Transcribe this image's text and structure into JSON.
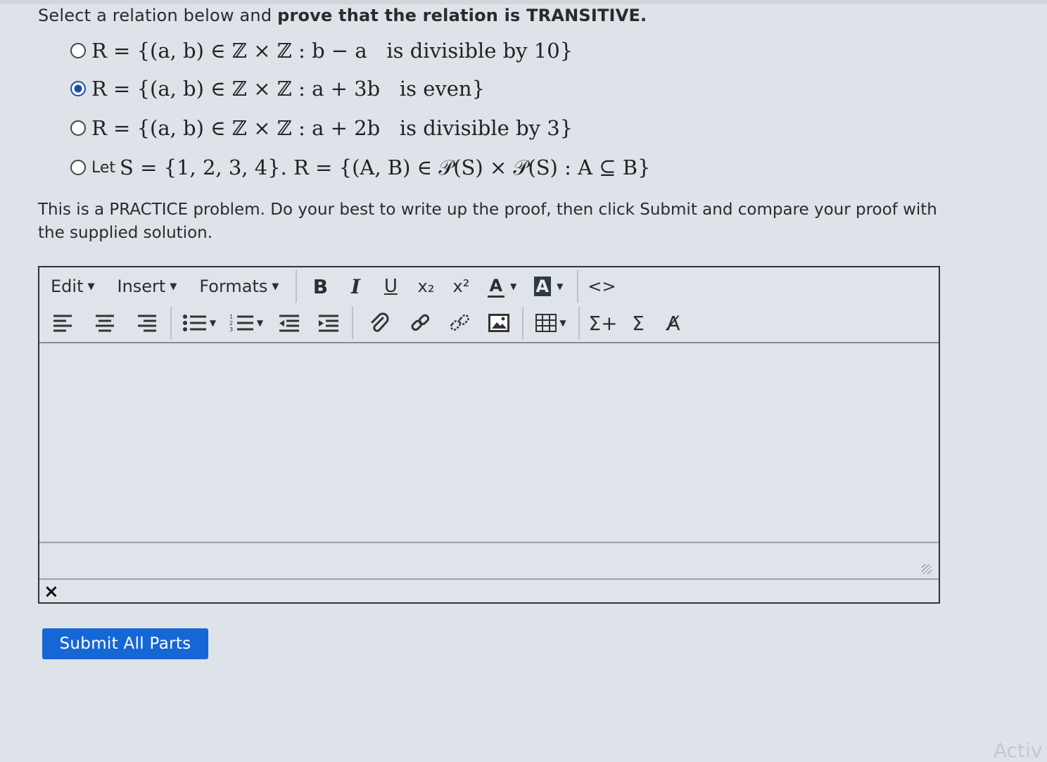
{
  "question": {
    "prompt_plain": "Select a relation below and ",
    "prompt_bold": "prove that the relation is TRANSITIVE."
  },
  "options": [
    {
      "prefix": "",
      "text": "R = {(a, b) ∈ ℤ × ℤ : b − a   is divisible by 10}",
      "selected": false
    },
    {
      "prefix": "",
      "text": "R = {(a, b) ∈ ℤ × ℤ : a + 3b   is even}",
      "selected": true
    },
    {
      "prefix": "",
      "text": "R = {(a, b) ∈ ℤ × ℤ : a + 2b   is divisible by 3}",
      "selected": false
    },
    {
      "prefix": "Let",
      "text": "S = {1, 2, 3, 4}. R = {(A, B) ∈ 𝒫(S) × 𝒫(S) : A ⊆ B}",
      "selected": false
    }
  ],
  "instructions": "This is a PRACTICE problem. Do your best to write up the proof, then click Submit and compare your proof with the supplied solution.",
  "toolbar": {
    "menus": [
      "Edit",
      "Insert",
      "Formats"
    ],
    "bold": "B",
    "italic": "I",
    "underline": "U",
    "subscript": "x₂",
    "superscript": "x²",
    "font_color": "A",
    "bg_color": "A",
    "code": "<>",
    "sum_plus": "Σ+",
    "sum": "Σ",
    "strike": "A̸"
  },
  "editor": {
    "value": ""
  },
  "close_label": "×",
  "submit_label": "Submit All Parts",
  "watermark": "Activ"
}
